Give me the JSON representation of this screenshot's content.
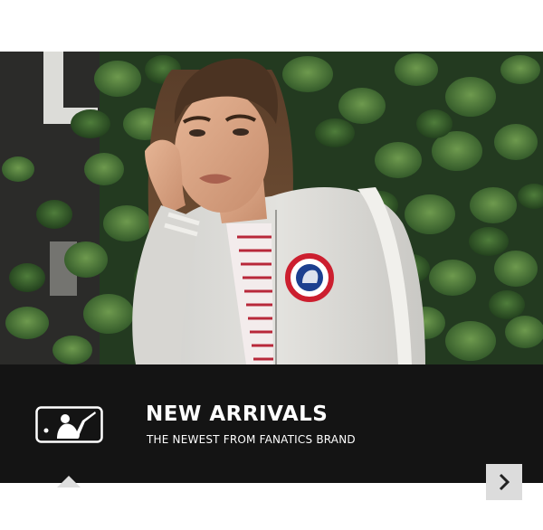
{
  "banner": {
    "headline": "NEW ARRIVALS",
    "subhead": "THE NEWEST FROM FANATICS BRAND",
    "logo": "mlb-batter-logo-icon",
    "next_icon": "chevron-right-icon"
  },
  "colors": {
    "caption_background": "#141414",
    "caption_text": "#ffffff",
    "next_button": "#dcdcdc",
    "pointer": "#dedede"
  }
}
